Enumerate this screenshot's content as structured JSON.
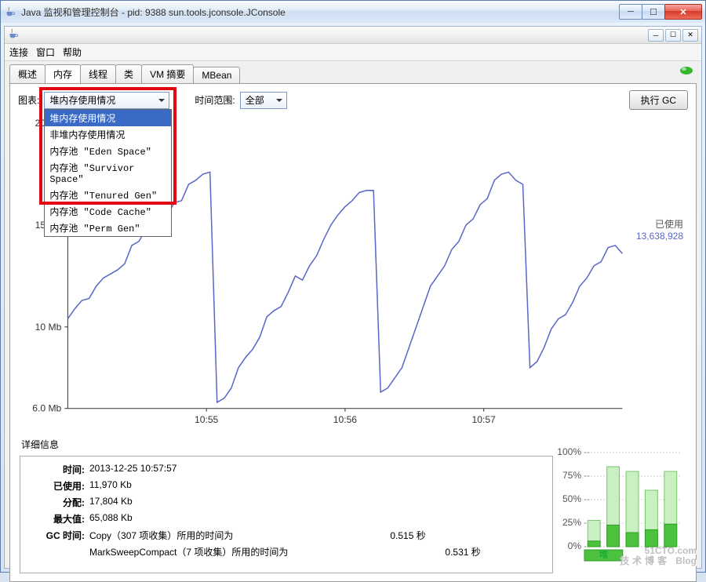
{
  "outer_window": {
    "title": "Java 监视和管理控制台 - pid: 9388 sun.tools.jconsole.JConsole"
  },
  "inner_window": {
    "menubar": [
      "连接",
      "窗口",
      "帮助"
    ],
    "tabs": [
      "概述",
      "内存",
      "线程",
      "类",
      "VM 摘要",
      "MBean"
    ],
    "active_tab_index": 1
  },
  "controls": {
    "chart_label": "图表:",
    "chart_combo_value": "堆内存使用情况",
    "range_label": "时间范围:",
    "range_value": "全部",
    "gc_button": "执行 GC"
  },
  "chart_dropdown_items": [
    "堆内存使用情况",
    "非堆内存使用情况",
    "内存池 \"Eden Space\"",
    "内存池 \"Survivor Space\"",
    "内存池 \"Tenured Gen\"",
    "内存池 \"Code Cache\"",
    "内存池 \"Perm Gen\""
  ],
  "used_label": {
    "title": "已使用",
    "value": "13,638,928"
  },
  "details": {
    "title": "详细信息",
    "time_label": "时间:",
    "time_value": "2013-12-25 10:57:57",
    "used_label": "已使用:",
    "used_value": "11,970 Kb",
    "alloc_label": "分配:",
    "alloc_value": "17,804 Kb",
    "max_label": "最大值:",
    "max_value": "65,088 Kb",
    "gc_label": "GC 时间:",
    "gc_line1_a": "Copy（307 项收集）所用的时间为",
    "gc_line1_b": "0.515 秒",
    "gc_line2_a": "MarkSweepCompact（7 项收集）所用的时间为",
    "gc_line2_b": "0.531 秒"
  },
  "chart_data": {
    "type": "line",
    "title": "",
    "xlabel": "",
    "ylabel": "",
    "y_ticks_mb": [
      6.0,
      10,
      15,
      20
    ],
    "x_ticks": [
      "10:55",
      "10:56",
      "10:57"
    ],
    "series": [
      {
        "name": "已使用",
        "color": "#5a67c8",
        "values_mb": [
          10.4,
          10.9,
          11.3,
          11.4,
          12.0,
          12.4,
          12.6,
          12.8,
          13.1,
          14.0,
          14.2,
          14.8,
          15.0,
          15.3,
          15.5,
          16.1,
          16.2,
          17.0,
          17.2,
          17.5,
          17.6,
          6.3,
          6.5,
          7.0,
          8.0,
          8.5,
          8.9,
          9.5,
          10.5,
          10.8,
          11.0,
          11.7,
          12.5,
          12.3,
          13.0,
          13.5,
          14.3,
          15.0,
          15.5,
          15.9,
          16.2,
          16.6,
          16.7,
          16.7,
          6.8,
          7.0,
          7.5,
          8.0,
          9.0,
          10.0,
          11.0,
          12.0,
          12.5,
          13.0,
          13.8,
          14.2,
          15.0,
          15.3,
          16.0,
          16.3,
          17.2,
          17.5,
          17.6,
          17.2,
          17.0,
          8.0,
          8.3,
          9.0,
          9.9,
          10.4,
          10.6,
          11.2,
          12.0,
          12.4,
          13.0,
          13.2,
          13.9,
          14.0,
          13.6
        ]
      }
    ]
  },
  "mini_bars": {
    "y_ticks": [
      "100%",
      "75%",
      "50%",
      "25%",
      "0%"
    ],
    "bars_pct": [
      {
        "alloc": 28,
        "used": 6
      },
      {
        "alloc": 85,
        "used": 23
      },
      {
        "alloc": 80,
        "used": 15
      },
      {
        "alloc": 60,
        "used": 18
      },
      {
        "alloc": 80,
        "used": 24
      }
    ],
    "active_index": 0
  },
  "watermark": {
    "line1": "51CTO.com",
    "line2": "技术博客",
    "line3": "Blog"
  }
}
